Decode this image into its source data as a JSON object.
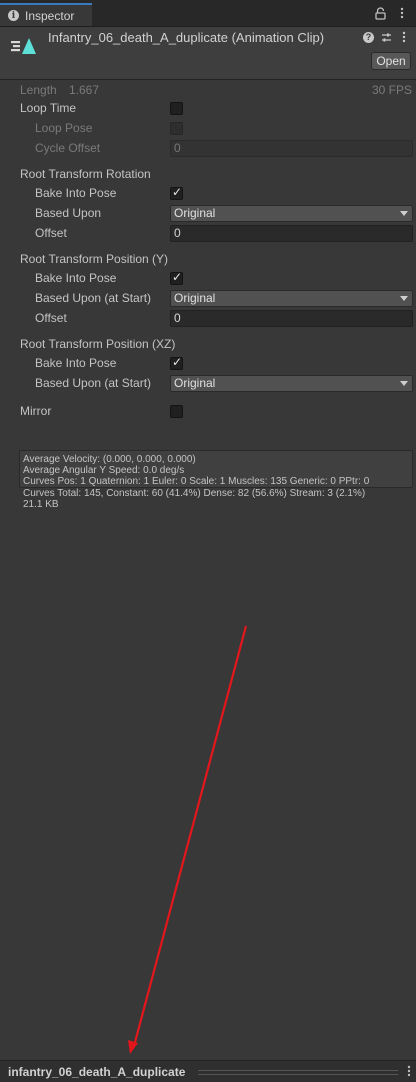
{
  "tab": {
    "label": "Inspector"
  },
  "header": {
    "title": "Infantry_06_death_A_duplicate (Animation Clip)",
    "open_label": "Open"
  },
  "clip": {
    "length_label": "Length",
    "length_value": "1.667",
    "fps": "30 FPS",
    "loop_time": "Loop Time",
    "loop_pose": "Loop Pose",
    "cycle_offset": "Cycle Offset",
    "cycle_offset_value": "0"
  },
  "rotation": {
    "section": "Root Transform Rotation",
    "bake_label": "Bake Into Pose",
    "based_label": "Based Upon",
    "based_value": "Original",
    "offset_label": "Offset",
    "offset_value": "0"
  },
  "position_y": {
    "section": "Root Transform Position (Y)",
    "bake_label": "Bake Into Pose",
    "based_label": "Based Upon (at Start)",
    "based_value": "Original",
    "offset_label": "Offset",
    "offset_value": "0"
  },
  "position_xz": {
    "section": "Root Transform Position (XZ)",
    "bake_label": "Bake Into Pose",
    "based_label": "Based Upon (at Start)",
    "based_value": "Original"
  },
  "mirror_label": "Mirror",
  "info": [
    "Average Velocity: (0.000, 0.000, 0.000)",
    "Average Angular Y Speed: 0.0 deg/s",
    "Curves Pos: 1 Quaternion: 1 Euler: 0 Scale: 1 Muscles: 135 Generic: 0 PPtr: 0",
    "Curves Total: 145, Constant: 60 (41.4%) Dense: 82 (56.6%) Stream: 3 (2.1%)",
    "21.1 KB"
  ],
  "bottom": {
    "name": "infantry_06_death_A_duplicate"
  },
  "colors": {
    "accent_tab": "#3a79bb",
    "arrow": "#e3161b",
    "clip_icon": "#5ce0d8"
  },
  "icons": {
    "tab": "info-icon",
    "lock": "lock-icon",
    "menu": "kebab-menu-icon",
    "help": "help-icon",
    "preset": "sliders-icon",
    "clip": "animation-clip-icon"
  }
}
